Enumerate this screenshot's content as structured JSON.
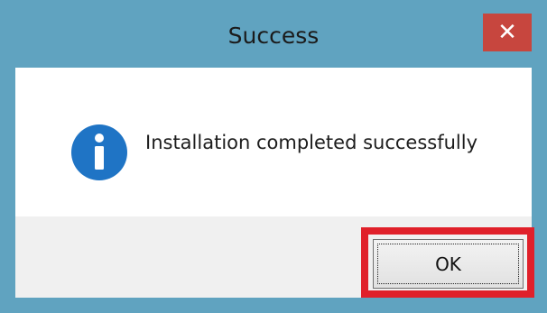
{
  "window": {
    "title": "Success",
    "close_glyph": "✕",
    "title_bar_color": "#60a3c0",
    "close_button_color": "#c7463e"
  },
  "dialog": {
    "icon": "info-icon",
    "message": "Installation completed successfully"
  },
  "buttons": {
    "ok_label": "OK"
  },
  "annotation": {
    "highlight_color": "#e0202a",
    "highlighted_element": "ok-button"
  }
}
